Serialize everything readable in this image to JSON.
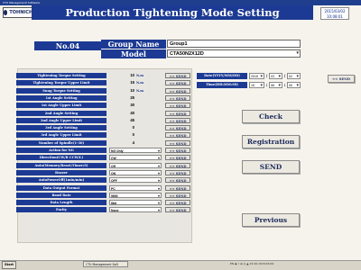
{
  "window": {
    "title": "CTU Management Software"
  },
  "logo": {
    "text": "TOHNICHI"
  },
  "header": {
    "title": "Production Tightening Mode Setting",
    "datetime_line1": "2015/03/02",
    "datetime_line2": "10:08:01",
    "no_label": "No.04",
    "group_label": "Group Name",
    "group_value": "Group1",
    "model_label": "Model",
    "model_value": "CTA50N2X12D"
  },
  "settings": [
    {
      "label": "Tightening Torque Setting",
      "value": "10",
      "unit": "N.m",
      "send": "<< SEND"
    },
    {
      "label": "Tightening Torque Upper Limit",
      "value": "15",
      "unit": "N.m",
      "send": "<< SEND"
    },
    {
      "label": "Snug Torque Setting",
      "value": "10",
      "unit": "N.m",
      "send": "<< SEND"
    },
    {
      "label": "1st Angle Setting",
      "value": "25",
      "unit": "",
      "send": "<< SEND"
    },
    {
      "label": "1st Angle Upper Limit",
      "value": "30",
      "unit": "",
      "send": "<< SEND"
    },
    {
      "label": "2nd Angle Setting",
      "value": "40",
      "unit": "",
      "send": "<< SEND"
    },
    {
      "label": "2nd Angle Upper Limit",
      "value": "45",
      "unit": "",
      "send": "<< SEND"
    },
    {
      "label": "3rd Angle Setting",
      "value": "0",
      "unit": "",
      "send": "<< SEND"
    },
    {
      "label": "3rd Angle Upper Limit",
      "value": "0",
      "unit": "",
      "send": "<< SEND"
    },
    {
      "label": "Number of Spindle(1-30)",
      "value": "4",
      "unit": "",
      "send": "<< SEND"
    }
  ],
  "selects": [
    {
      "label": "Action for NG",
      "value": "NG Only",
      "send": "<< SEND"
    },
    {
      "label": "Direction(CW/R CCW/L)",
      "value": "CW",
      "send": "<< SEND"
    },
    {
      "label": "Auto(Memory/Reset/Timer/S)",
      "value": "Off",
      "send": "<< SEND"
    },
    {
      "label": "Buzzer",
      "value": "ON",
      "send": "<< SEND"
    },
    {
      "label": "AutoPowerOff(1min/min)",
      "value": "OFF",
      "send": "<< SEND"
    },
    {
      "label": "Data Output Format",
      "value": "PC",
      "send": "<< SEND"
    },
    {
      "label": "Baud Rate",
      "value": "9600",
      "send": "<< SEND"
    },
    {
      "label": "Data Length",
      "value": "8bit",
      "send": "<< SEND"
    },
    {
      "label": "Parity",
      "value": "None",
      "send": "<< SEND"
    }
  ],
  "datetime": {
    "date_label": "Date(YYYY/MM/DD)",
    "time_label": "Time(HH:MM:SS)",
    "year": "2015",
    "month": "03",
    "day": "02",
    "hour": "15",
    "minute": "06",
    "second": "00",
    "date_sep": "/",
    "time_sep": ":",
    "send": "<< SEND"
  },
  "actions": {
    "check": "Check",
    "registration": "Registration",
    "send": "SEND",
    "previous": "Previous"
  },
  "taskbar": {
    "start": "Start",
    "item1": "CTU Management Soft",
    "tray": "EN  ◆  ♪  ⊞  ◎  ▲  15:06  2015/03/02"
  }
}
